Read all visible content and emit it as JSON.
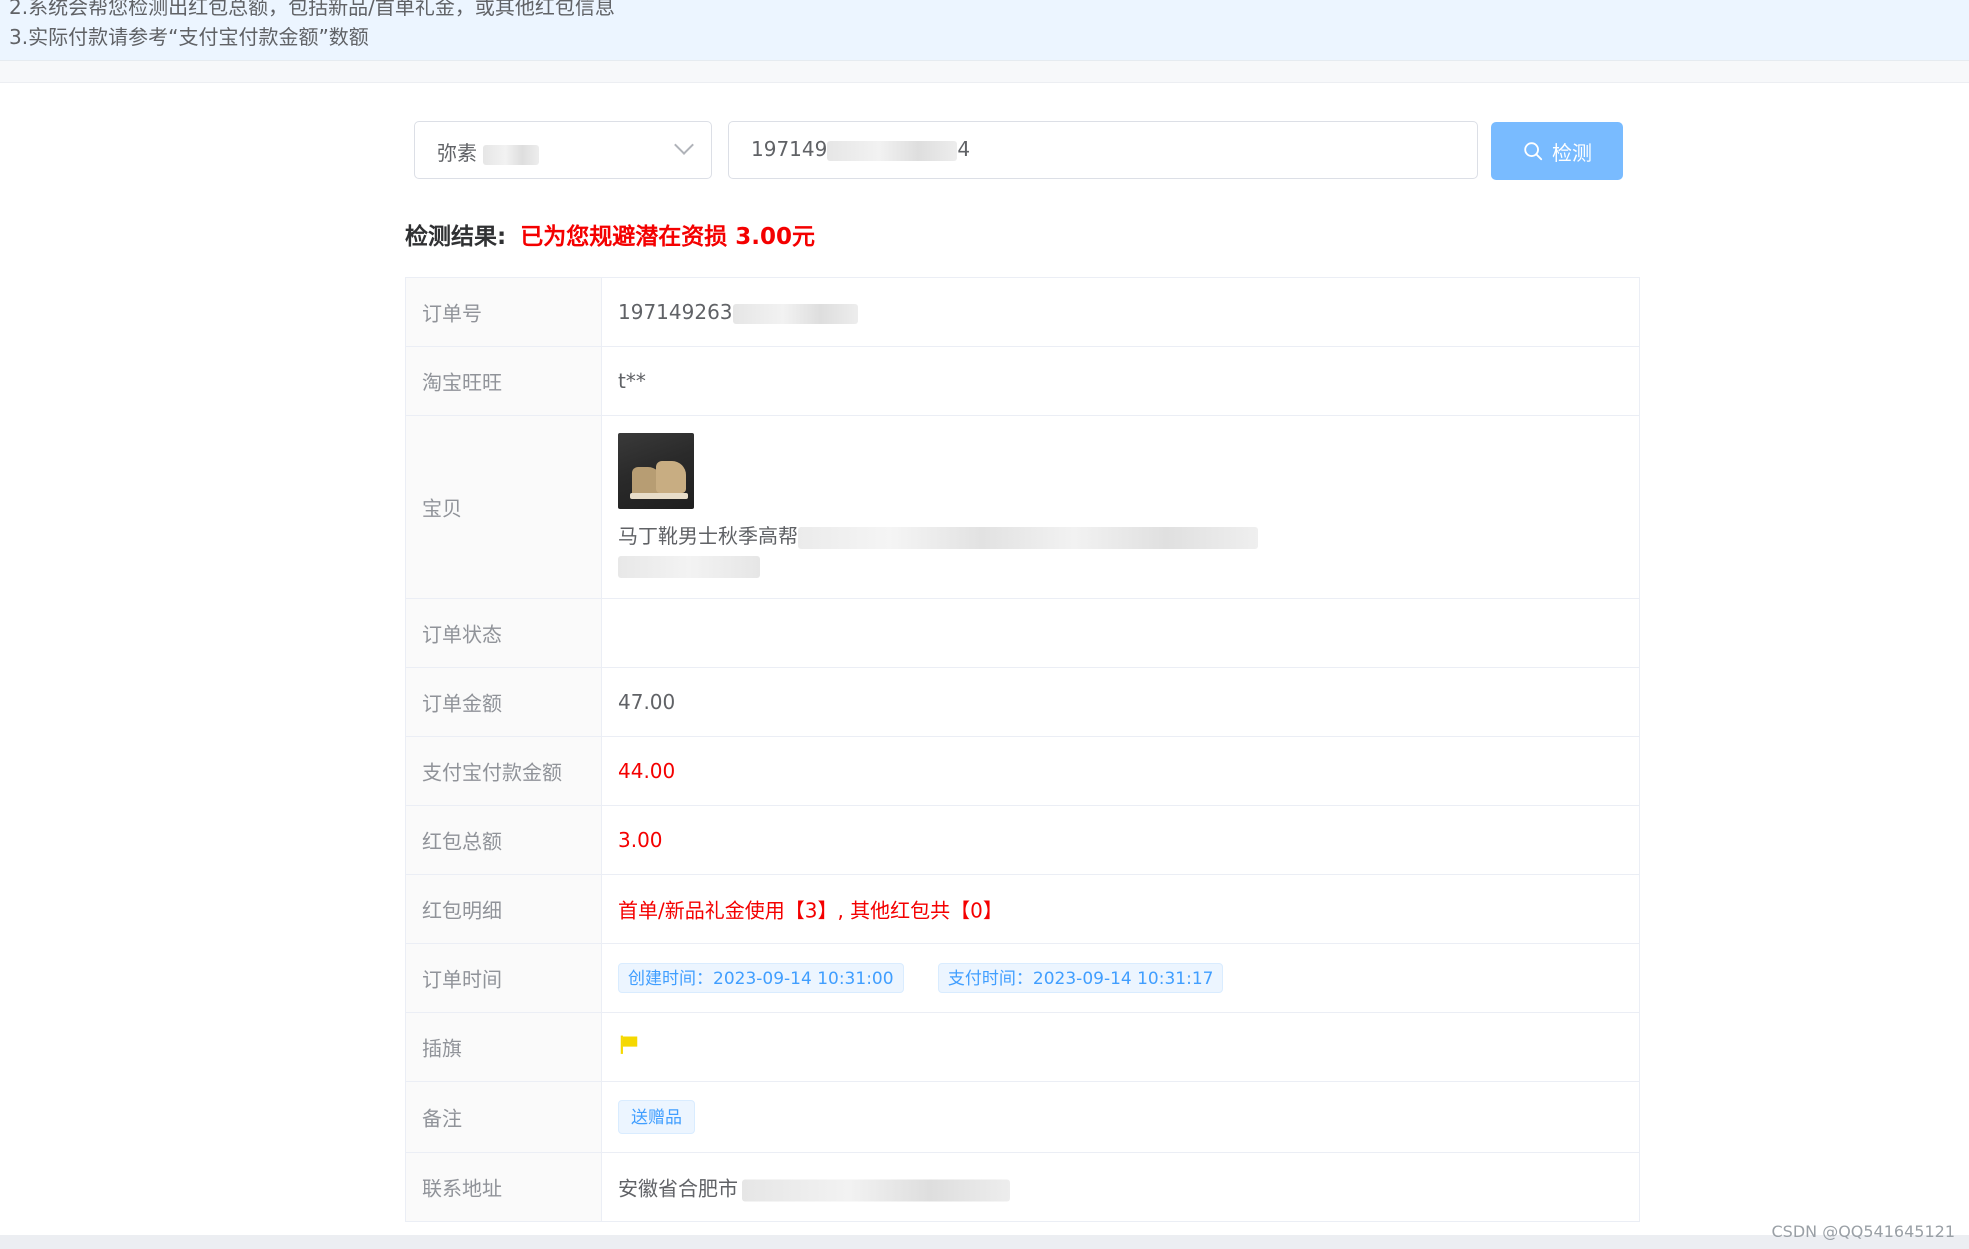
{
  "notice": {
    "line2": "2.系统会帮您检测出红包总额，包括新品/首单礼金，或其他红包信息",
    "line3": "3.实际付款请参考“支付宝付款金额”数额"
  },
  "search": {
    "shop_value": "弥素",
    "order_value": "197149",
    "order_suffix": "4",
    "detect_label": "检测"
  },
  "result": {
    "label": "检测结果:",
    "text": "已为您规避潜在资损 3.00元"
  },
  "table": {
    "order_no": {
      "label": "订单号",
      "value": "197149263"
    },
    "wangwang": {
      "label": "淘宝旺旺",
      "value": "t**"
    },
    "goods": {
      "label": "宝贝",
      "title": "马丁靴男士秋季高帮"
    },
    "status": {
      "label": "订单状态",
      "value": ""
    },
    "amount": {
      "label": "订单金额",
      "value": "47.00"
    },
    "alipay": {
      "label": "支付宝付款金额",
      "value": "44.00"
    },
    "redpack_total": {
      "label": "红包总额",
      "value": "3.00"
    },
    "redpack_detail": {
      "label": "红包明细",
      "value": "首单/新品礼金使用【3】, 其他红包共【0】"
    },
    "order_time": {
      "label": "订单时间",
      "created": "创建时间：2023-09-14 10:31:00",
      "paid": "支付时间：2023-09-14 10:31:17"
    },
    "flag": {
      "label": "插旗",
      "color": "#f5d800"
    },
    "remark": {
      "label": "备注",
      "tag": "送赠品"
    },
    "address": {
      "label": "联系地址",
      "value": "安徽省合肥市"
    }
  },
  "colors": {
    "accent": "#79bbff",
    "danger": "#f40000",
    "tag_blue": "#409eff"
  },
  "watermark": "CSDN @QQ541645121"
}
